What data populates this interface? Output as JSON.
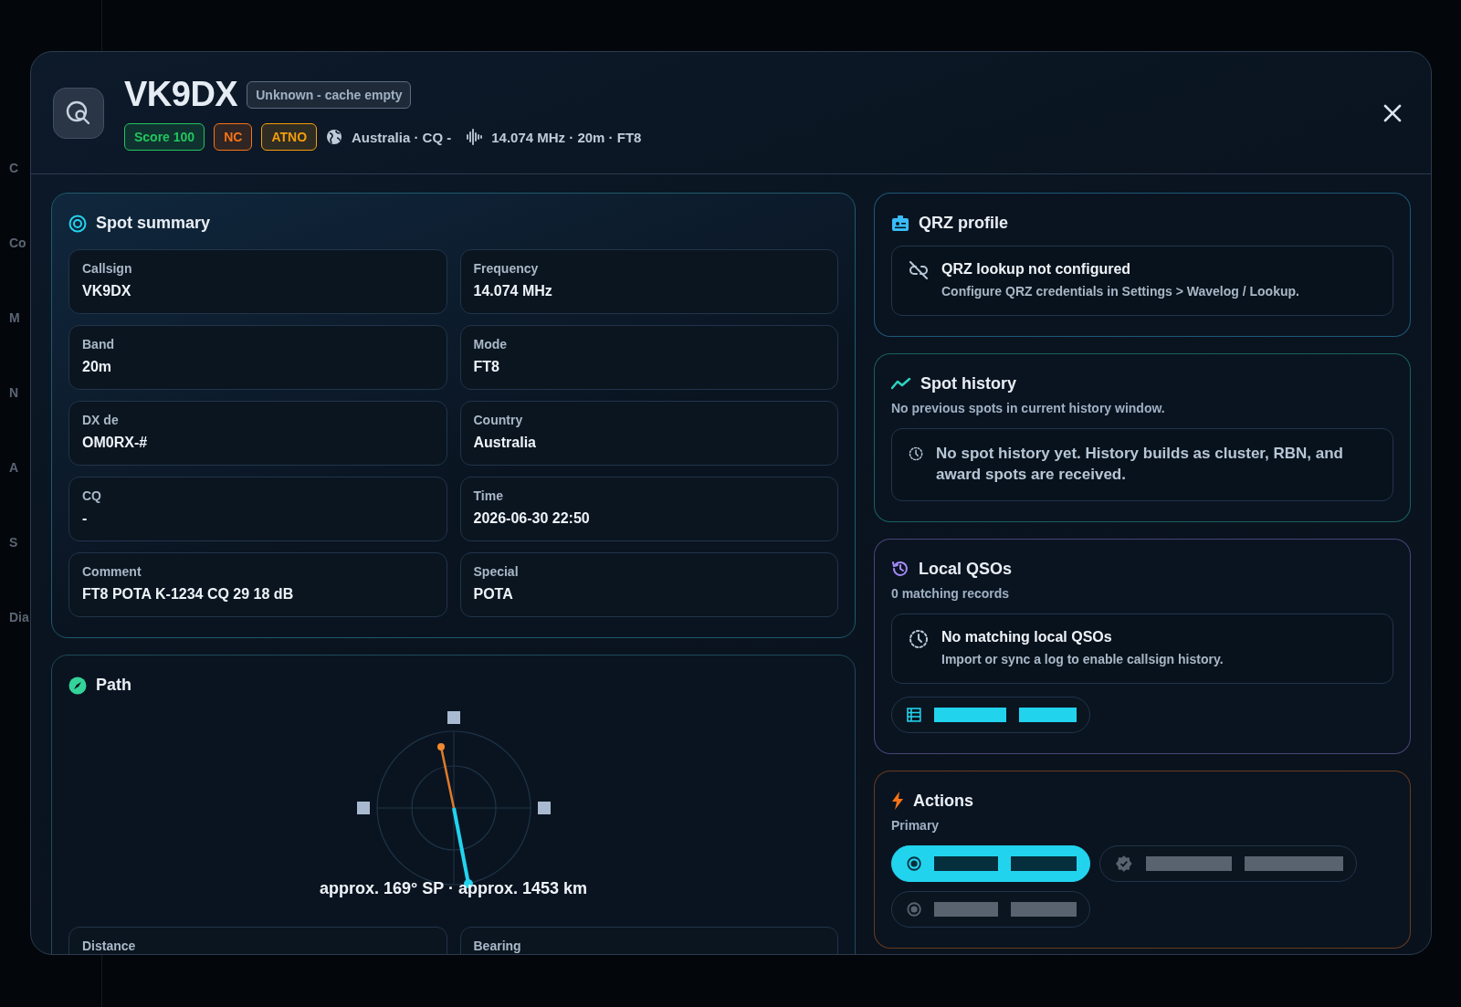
{
  "backdrop": {
    "sidebar_fragments": [
      "C",
      "Co",
      "M",
      "N",
      "A",
      "S",
      "Dia"
    ]
  },
  "dialog": {
    "title": "VK9DX",
    "status_badge": "Unknown - cache empty",
    "badges": [
      {
        "label": "Score 100",
        "color": "#22c55e"
      },
      {
        "label": "NC",
        "color": "#f97316"
      },
      {
        "label": "ATNO",
        "color": "#f59e0b"
      }
    ],
    "location": "Australia · CQ -",
    "frequency_line": "14.074 MHz · 20m · FT8"
  },
  "spot_summary": {
    "title": "Spot summary",
    "fields": [
      {
        "label": "Callsign",
        "value": "VK9DX"
      },
      {
        "label": "Frequency",
        "value": "14.074 MHz"
      },
      {
        "label": "Band",
        "value": "20m"
      },
      {
        "label": "Mode",
        "value": "FT8"
      },
      {
        "label": "DX de",
        "value": "OM0RX-#"
      },
      {
        "label": "Country",
        "value": "Australia"
      },
      {
        "label": "CQ",
        "value": "-"
      },
      {
        "label": "Time",
        "value": "2026-06-30 22:50"
      },
      {
        "label": "Comment",
        "value": "FT8 POTA K-1234 CQ 29 18 dB"
      },
      {
        "label": "Special",
        "value": "POTA"
      }
    ]
  },
  "path": {
    "title": "Path",
    "summary": "approx. 169° SP · approx. 1453 km",
    "fields": [
      {
        "label": "Distance"
      },
      {
        "label": "Bearing"
      }
    ]
  },
  "panels": [
    {
      "kind": "profile",
      "title": "QRZ profile",
      "color": "#38bdf8",
      "notice": {
        "title": "QRZ lookup not configured",
        "text": "Configure QRZ credentials in Settings > Wavelog / Lookup."
      }
    },
    {
      "kind": "history",
      "title": "Spot history",
      "color": "#2dd4bf",
      "subtitle": "No previous spots in current history window.",
      "notice": {
        "text": "No spot history yet. History builds as cluster, RBN, and award spots are received."
      }
    },
    {
      "kind": "qsos",
      "title": "Local QSOs",
      "color": "#a78bfa",
      "subtitle": "0 matching records",
      "notice": {
        "title": "No matching local QSOs",
        "text": "Import or sync a log to enable callsign history."
      }
    },
    {
      "kind": "actions",
      "title": "Actions",
      "color": "#f97316",
      "subtitle": "Primary",
      "actions": [
        {
          "selected": true
        },
        {
          "selected": false
        },
        {
          "selected": false
        }
      ]
    }
  ]
}
